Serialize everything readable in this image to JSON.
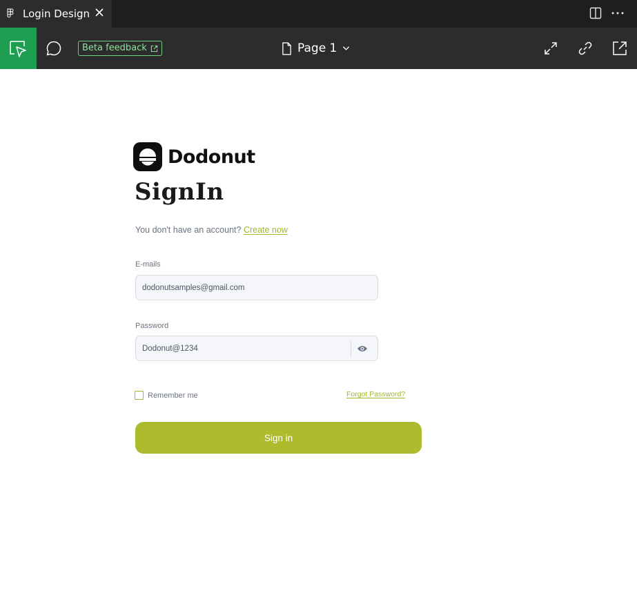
{
  "tab": {
    "title": "Login Design"
  },
  "toolbar": {
    "beta_label": "Beta feedback",
    "page_label": "Page 1"
  },
  "colors": {
    "accent": "#adbb2d",
    "tool_active": "#1e9e50",
    "chrome_dark": "#2c2c2c"
  },
  "form": {
    "brand": "Dodonut",
    "title": "SignIn",
    "account_prompt": "You don't have an account?",
    "create_link": "Create now",
    "email_label": "E-mails",
    "email_value": "dodonutsamples@gmail.com",
    "password_label": "Password",
    "password_value": "Dodonut@1234",
    "remember_label": "Remember me",
    "forgot_label": "Forgot Password?",
    "submit_label": "Sign in"
  },
  "icons": {
    "tab": "figma-icon",
    "close": "close-icon",
    "split": "split-view-icon",
    "more": "more-icon",
    "select": "cursor-select-icon",
    "comment": "comment-icon",
    "external": "external-link-icon",
    "page": "page-icon",
    "dropdown": "chevron-down-icon",
    "expand": "expand-icon",
    "link": "link-icon",
    "share": "share-out-icon",
    "eye": "eye-icon"
  }
}
